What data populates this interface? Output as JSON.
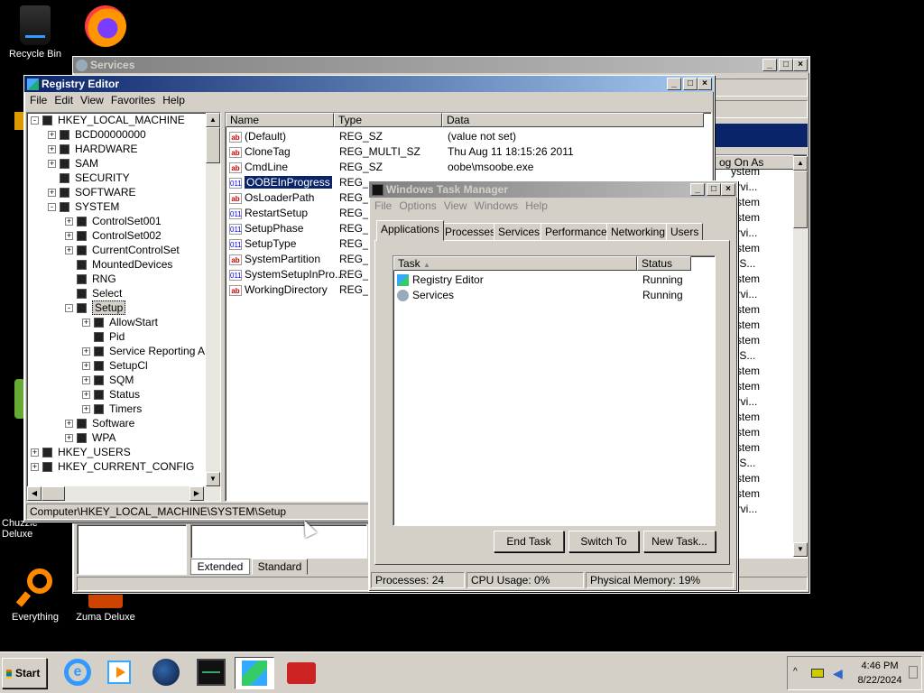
{
  "desktop": {
    "icons": [
      {
        "label": "Recycle Bin"
      },
      {
        "label": "Everything"
      },
      {
        "label": "Zuma Deluxe"
      },
      {
        "label": "Chuzzle Deluxe"
      }
    ]
  },
  "services_window": {
    "title": "Services",
    "tabs": [
      "Extended",
      "Standard"
    ],
    "log_on_as_header": "og On As",
    "log_on_rows": [
      "ystem",
      "ervi...",
      "ystem",
      "ystem",
      "ervi...",
      "ystem",
      "k S...",
      "ystem",
      "ervi...",
      "ystem",
      "ystem",
      "ystem",
      "k S...",
      "ystem",
      "ystem",
      "ervi...",
      "ystem",
      "ystem",
      "ystem",
      "k S...",
      "ystem",
      "ystem",
      "ervi..."
    ]
  },
  "registry_editor": {
    "title": "Registry Editor",
    "menu": [
      "File",
      "Edit",
      "View",
      "Favorites",
      "Help"
    ],
    "tree": [
      {
        "label": "HKEY_LOCAL_MACHINE",
        "level": 0,
        "sign": "-"
      },
      {
        "label": "BCD00000000",
        "level": 1,
        "sign": "+"
      },
      {
        "label": "HARDWARE",
        "level": 1,
        "sign": "+"
      },
      {
        "label": "SAM",
        "level": 1,
        "sign": "+"
      },
      {
        "label": "SECURITY",
        "level": 1,
        "sign": ""
      },
      {
        "label": "SOFTWARE",
        "level": 1,
        "sign": "+"
      },
      {
        "label": "SYSTEM",
        "level": 1,
        "sign": "-"
      },
      {
        "label": "ControlSet001",
        "level": 2,
        "sign": "+"
      },
      {
        "label": "ControlSet002",
        "level": 2,
        "sign": "+"
      },
      {
        "label": "CurrentControlSet",
        "level": 2,
        "sign": "+"
      },
      {
        "label": "MountedDevices",
        "level": 2,
        "sign": ""
      },
      {
        "label": "RNG",
        "level": 2,
        "sign": ""
      },
      {
        "label": "Select",
        "level": 2,
        "sign": ""
      },
      {
        "label": "Setup",
        "level": 2,
        "sign": "-"
      },
      {
        "label": "AllowStart",
        "level": 3,
        "sign": "+"
      },
      {
        "label": "Pid",
        "level": 3,
        "sign": ""
      },
      {
        "label": "Service Reporting API",
        "level": 3,
        "sign": "+"
      },
      {
        "label": "SetupCl",
        "level": 3,
        "sign": "+"
      },
      {
        "label": "SQM",
        "level": 3,
        "sign": "+"
      },
      {
        "label": "Status",
        "level": 3,
        "sign": "+"
      },
      {
        "label": "Timers",
        "level": 3,
        "sign": "+"
      },
      {
        "label": "Software",
        "level": 2,
        "sign": "+"
      },
      {
        "label": "WPA",
        "level": 2,
        "sign": "+"
      },
      {
        "label": "HKEY_USERS",
        "level": 0,
        "sign": "+"
      },
      {
        "label": "HKEY_CURRENT_CONFIG",
        "level": 0,
        "sign": "+"
      }
    ],
    "columns": [
      "Name",
      "Type",
      "Data"
    ],
    "values": [
      {
        "icon": "ab",
        "name": "(Default)",
        "type": "REG_SZ",
        "data": "(value not set)"
      },
      {
        "icon": "ab",
        "name": "CloneTag",
        "type": "REG_MULTI_SZ",
        "data": "Thu Aug 11 18:15:26 2011"
      },
      {
        "icon": "ab",
        "name": "CmdLine",
        "type": "REG_SZ",
        "data": "oobe\\msoobe.exe"
      },
      {
        "icon": "bin",
        "name": "OOBEInProgress",
        "type": "REG_",
        "data": ""
      },
      {
        "icon": "ab",
        "name": "OsLoaderPath",
        "type": "REG_",
        "data": ""
      },
      {
        "icon": "bin",
        "name": "RestartSetup",
        "type": "REG_",
        "data": ""
      },
      {
        "icon": "bin",
        "name": "SetupPhase",
        "type": "REG_",
        "data": ""
      },
      {
        "icon": "bin",
        "name": "SetupType",
        "type": "REG_",
        "data": ""
      },
      {
        "icon": "ab",
        "name": "SystemPartition",
        "type": "REG_",
        "data": ""
      },
      {
        "icon": "bin",
        "name": "SystemSetupInPro...",
        "type": "REG_",
        "data": ""
      },
      {
        "icon": "ab",
        "name": "WorkingDirectory",
        "type": "REG_",
        "data": ""
      }
    ],
    "status_path": "Computer\\HKEY_LOCAL_MACHINE\\SYSTEM\\Setup"
  },
  "task_manager": {
    "title": "Windows Task Manager",
    "menu": [
      "File",
      "Options",
      "View",
      "Windows",
      "Help"
    ],
    "tabs": [
      "Applications",
      "Processes",
      "Services",
      "Performance",
      "Networking",
      "Users"
    ],
    "columns": [
      "Task",
      "Status"
    ],
    "tasks": [
      {
        "name": "Registry Editor",
        "status": "Running"
      },
      {
        "name": "Services",
        "status": "Running"
      }
    ],
    "buttons": {
      "end_task": "End Task",
      "switch_to": "Switch To",
      "new_task": "New Task..."
    },
    "status": {
      "processes": "Processes: 24",
      "cpu": "CPU Usage: 0%",
      "memory": "Physical Memory: 19%"
    }
  },
  "taskbar": {
    "start_label": "Start",
    "time": "4:46 PM",
    "date": "8/22/2024"
  }
}
